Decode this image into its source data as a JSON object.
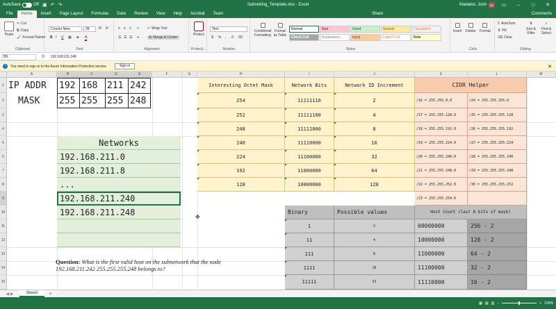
{
  "window": {
    "autosave_label": "AutoSave",
    "autosave_state": "Off",
    "title": "Subnetting_Template.xlsx - Excel",
    "user_name": "Madakor, Josh",
    "user_initials": "MJ"
  },
  "menu": {
    "tabs": [
      "File",
      "Home",
      "Insert",
      "Page Layout",
      "Formulas",
      "Data",
      "Review",
      "View",
      "Help",
      "Acrobat",
      "Team"
    ],
    "share": "Share",
    "comments": "Comments"
  },
  "ribbon": {
    "clipboard": {
      "label": "Clipboard",
      "paste": "Paste",
      "cut": "Cut",
      "copy": "Copy",
      "format_painter": "Format Painter"
    },
    "font": {
      "label": "Font",
      "name": "Courier New",
      "size": "28"
    },
    "alignment": {
      "label": "Alignment",
      "wrap_text": "Wrap Text",
      "merge_center": "Merge & Center"
    },
    "protect": {
      "label": "Protecti...",
      "protect": "Protect"
    },
    "number": {
      "label": "Number",
      "format": "Text"
    },
    "styles": {
      "label": "Styles",
      "conditional": "Conditional Formatting",
      "format_table": "Format as Table",
      "cells": [
        {
          "name": "Normal",
          "bg": "#ffffff",
          "fg": "#000000"
        },
        {
          "name": "Bad",
          "bg": "#ffc7ce",
          "fg": "#9c0006"
        },
        {
          "name": "Good",
          "bg": "#c6efce",
          "fg": "#006100"
        },
        {
          "name": "Neutral",
          "bg": "#ffeb9c",
          "fg": "#9c5700"
        },
        {
          "name": "Calculation",
          "bg": "#f2f2f2",
          "fg": "#fa7d00"
        },
        {
          "name": "Check Cell",
          "bg": "#a5a5a5",
          "fg": "#ffffff"
        },
        {
          "name": "Explanatory ...",
          "bg": "#ffffff",
          "fg": "#7f7f7f"
        },
        {
          "name": "Input",
          "bg": "#ffcc99",
          "fg": "#3f3f76"
        },
        {
          "name": "Linked Cell",
          "bg": "#ffffff",
          "fg": "#fa7d00"
        },
        {
          "name": "Note",
          "bg": "#ffffcc",
          "fg": "#000000"
        }
      ]
    },
    "cells_grp": {
      "label": "Cells",
      "insert": "Insert",
      "delete": "Delete",
      "format": "Format"
    },
    "editing": {
      "label": "Editing",
      "autosum": "AutoSum",
      "fill": "Fill",
      "clear": "Clear",
      "sort": "Sort & Filter",
      "find": "Find & Select"
    }
  },
  "formula_bar": {
    "name_box": "B9",
    "fx": "fx",
    "value": "192.168.211.240"
  },
  "info_bar": {
    "message": "You need to sign in to the Azure Information Protection service",
    "button": "Sign in"
  },
  "columns": [
    "A",
    "B",
    "C",
    "D",
    "E",
    "F",
    "G",
    "H",
    "I",
    "J",
    "K",
    "L",
    "M"
  ],
  "rows": [
    "1",
    "2",
    "3",
    "4",
    "5",
    "6",
    "7",
    "8",
    "9",
    "10",
    "11",
    "12",
    "13",
    "14",
    "15"
  ],
  "ip_block": {
    "ip_label": "IP ADDR",
    "ip_octets": [
      "192",
      "168",
      "211",
      "242"
    ],
    "mask_label": "MASK",
    "mask_octets": [
      "255",
      "255",
      "255",
      "248"
    ]
  },
  "networks": {
    "header": "Networks",
    "items": [
      "192.168.211.0",
      "192.168.211.8",
      "...",
      "192.168.211.240",
      "192.168.211.248",
      "",
      ""
    ]
  },
  "mask_table": {
    "headers": [
      "Interesting Octet Mask",
      "Network Bits",
      "Network ID Increment"
    ],
    "rows": [
      [
        "254",
        "11111110",
        "2"
      ],
      [
        "252",
        "11111100",
        "4"
      ],
      [
        "248",
        "11111000",
        "8"
      ],
      [
        "240",
        "11110000",
        "16"
      ],
      [
        "224",
        "11100000",
        "32"
      ],
      [
        "192",
        "11000000",
        "64"
      ],
      [
        "128",
        "10000000",
        "128"
      ]
    ]
  },
  "cidr": {
    "header": "CIDR Helper",
    "left": [
      "/16 = 255.255.0.0",
      "/17 = 255.255.128.0",
      "/18 = 255.255.192.0",
      "/19 = 255.255.224.0",
      "/20 = 255.255.240.0",
      "/21 = 255.255.248.0",
      "/22 = 255.255.252.0",
      "/23 = 255.255.254.0"
    ],
    "right": [
      "/24 = 255.255.255.0",
      "/25 = 255.255.255.128",
      "/26 = 255.255.255.192",
      "/27 = 255.255.255.224",
      "/28 = 255.255.255.240",
      "/29 = 255.255.255.248",
      "/30 = 255.255.255.252",
      ""
    ]
  },
  "binary_table": {
    "headers": [
      "Binary",
      "Possible values"
    ],
    "rows": [
      [
        "1",
        "2"
      ],
      [
        "11",
        "4"
      ],
      [
        "111",
        "8"
      ],
      [
        "1111",
        "16"
      ],
      [
        "11111",
        "32"
      ]
    ]
  },
  "host_table": {
    "header": "Host Count (last 8 bits of mask)",
    "rows": [
      [
        "00000000",
        "256 - 2"
      ],
      [
        "10000000",
        "128 - 2"
      ],
      [
        "11000000",
        "64 - 2"
      ],
      [
        "11100000",
        "32 - 2"
      ],
      [
        "11110000",
        "16 - 2"
      ]
    ]
  },
  "question": {
    "label": "Question:",
    "text": "What is the first valid host on the subnetwork that the node 192.168.211.242 255.255.255.248 belongs to?"
  },
  "sheets": {
    "tabs": [
      "Sheet1"
    ],
    "add": "+"
  },
  "status": {
    "ready": "",
    "zoom": "100%"
  }
}
